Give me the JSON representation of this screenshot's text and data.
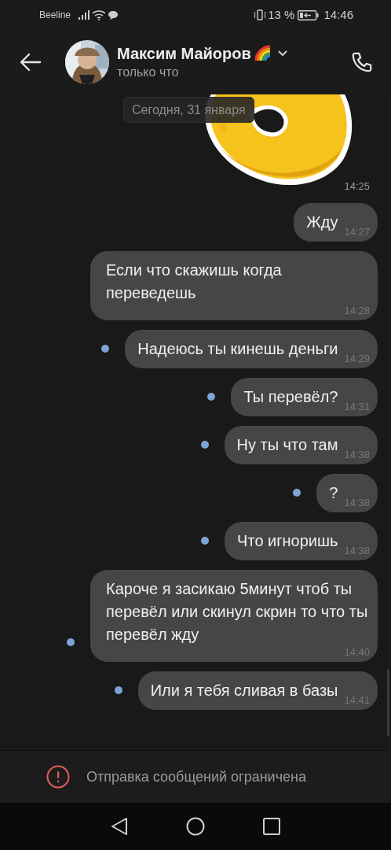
{
  "status_bar": {
    "carrier": "Beeline",
    "battery": "13 %",
    "time": "14:46"
  },
  "header": {
    "name": "Максим Майоров",
    "status": "только что"
  },
  "date_divider": "Сегодня, 31 января",
  "sticker": {
    "time": "14:25"
  },
  "messages": [
    {
      "text": "Жду",
      "time": "14:27",
      "unread": false
    },
    {
      "text": "Если что скажишь когда переведешь",
      "time": "14:28",
      "unread": false
    },
    {
      "text": "Надеюсь ты кинешь деньги",
      "time": "14:29",
      "unread": true
    },
    {
      "text": "Ты перевёл?",
      "time": "14:31",
      "unread": true
    },
    {
      "text": "Ну ты что там",
      "time": "14:38",
      "unread": true
    },
    {
      "text": "?",
      "time": "14:38",
      "unread": true
    },
    {
      "text": "Что игноришь",
      "time": "14:38",
      "unread": true
    },
    {
      "text": "Кароче я засикаю 5минут чтоб ты перевёл или скинул скрин то что ты перевёл жду",
      "time": "14:40",
      "unread": true
    },
    {
      "text": "Или я тебя сливая в базы",
      "time": "14:41",
      "unread": true
    }
  ],
  "footer": {
    "notice": "Отправка сообщений ограничена"
  }
}
